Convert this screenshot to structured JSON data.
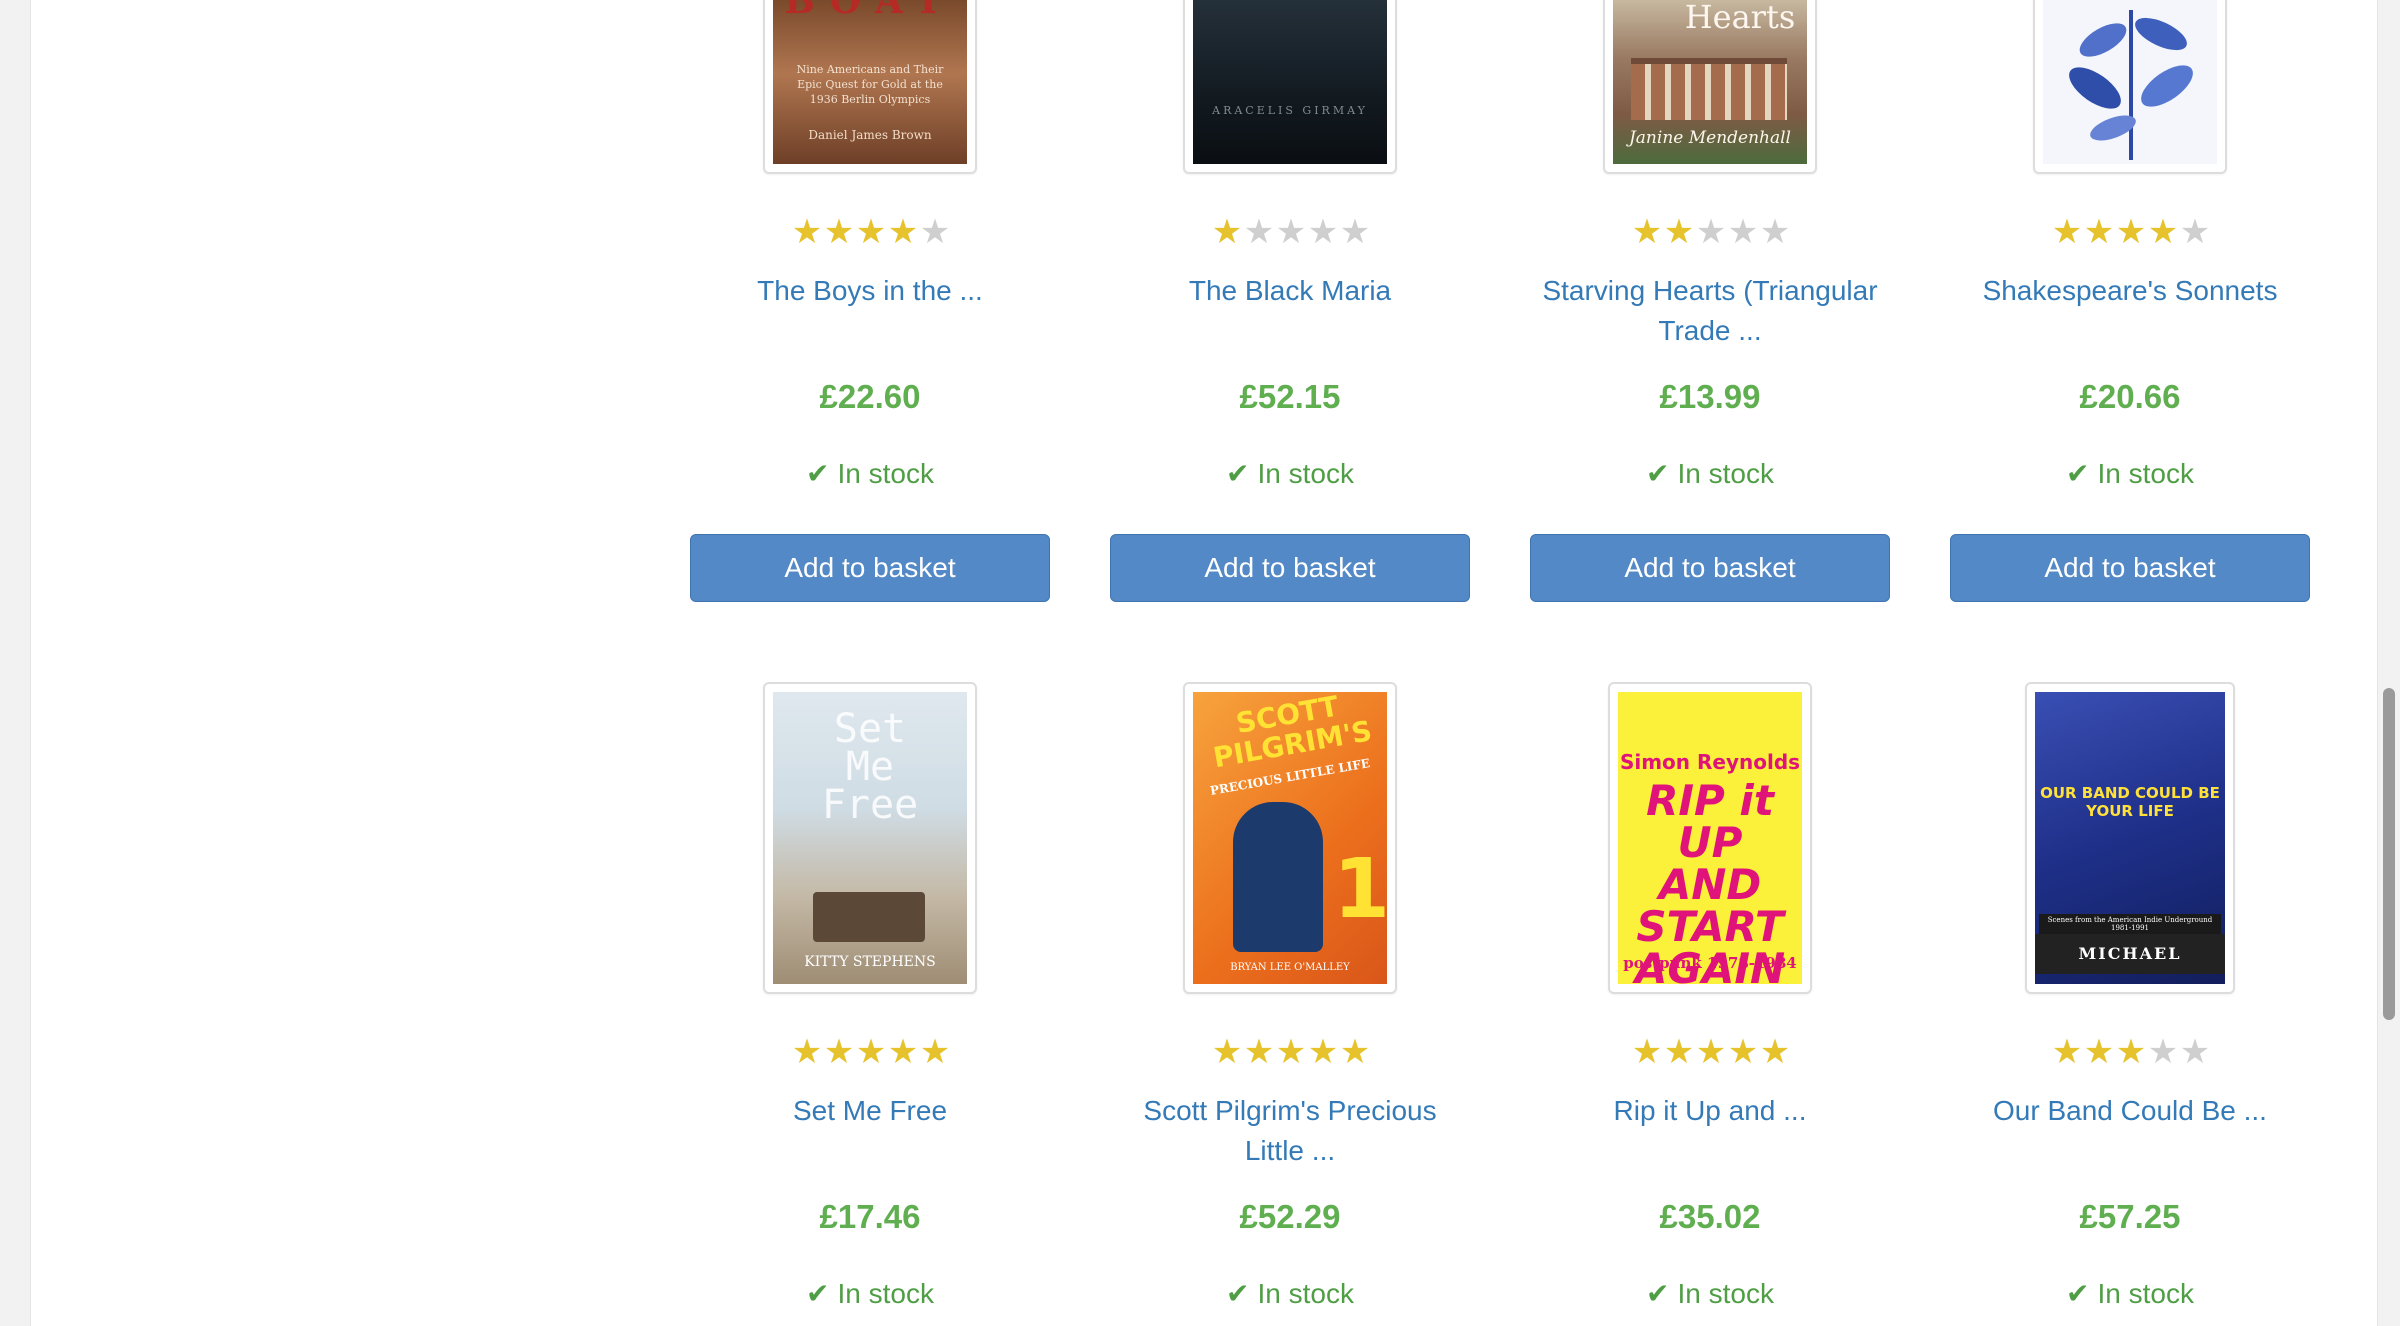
{
  "products": [
    {
      "title": "The Boys in the ...",
      "rating": 4,
      "price": "£22.60",
      "stock": "In stock",
      "button": "Add to basket",
      "cover": {
        "heading": "BOAT",
        "subtitle": "Nine Americans and Their Epic Quest for Gold at the 1936 Berlin Olympics",
        "author": "Daniel James Brown"
      }
    },
    {
      "title": "The Black Maria",
      "rating": 1,
      "price": "£52.15",
      "stock": "In stock",
      "button": "Add to basket",
      "cover": {
        "heading": "",
        "subtitle": "",
        "author": "ARACELIS GIRMAY"
      }
    },
    {
      "title": "Starving Hearts (Triangular Trade ...",
      "rating": 2,
      "price": "£13.99",
      "stock": "In stock",
      "button": "Add to basket",
      "cover": {
        "heading": "Hearts",
        "subtitle": "",
        "author": "Janine Mendenhall"
      }
    },
    {
      "title": "Shakespeare's Sonnets",
      "rating": 4,
      "price": "£20.66",
      "stock": "In stock",
      "button": "Add to basket",
      "cover": {
        "heading": "",
        "subtitle": "",
        "author": ""
      }
    },
    {
      "title": "Set Me Free",
      "rating": 5,
      "price": "£17.46",
      "stock": "In stock",
      "button": "Add to basket",
      "cover": {
        "heading": "Set Me Free",
        "subtitle": "",
        "author": "KITTY STEPHENS"
      }
    },
    {
      "title": "Scott Pilgrim's Precious Little ...",
      "rating": 5,
      "price": "£52.29",
      "stock": "In stock",
      "button": "Add to basket",
      "cover": {
        "heading": "SCOTT PILGRIM'S",
        "subtitle": "PRECIOUS LITTLE LIFE",
        "author": "BRYAN LEE O'MALLEY"
      }
    },
    {
      "title": "Rip it Up and ...",
      "rating": 5,
      "price": "£35.02",
      "stock": "In stock",
      "button": "Add to basket",
      "cover": {
        "heading": "RIP it UP AND START AGAIN",
        "subtitle": "postpunk 1978-1984",
        "author": "Simon Reynolds"
      }
    },
    {
      "title": "Our Band Could Be ...",
      "rating": 3,
      "price": "£57.25",
      "stock": "In stock",
      "button": "Add to basket",
      "cover": {
        "heading": "OUR BAND COULD BE YOUR LIFE",
        "subtitle": "Scenes from the American Indie Underground 1981-1991",
        "author": "MICHAEL AZERRAD"
      }
    }
  ],
  "icons": {
    "star": "star-icon",
    "check": "check-icon"
  },
  "colors": {
    "title_link": "#337ab7",
    "price": "#5fae4f",
    "stock": "#4f9e45",
    "button": "#5289c6",
    "star_on": "#e6c32d",
    "star_off": "#cfcfcf"
  }
}
